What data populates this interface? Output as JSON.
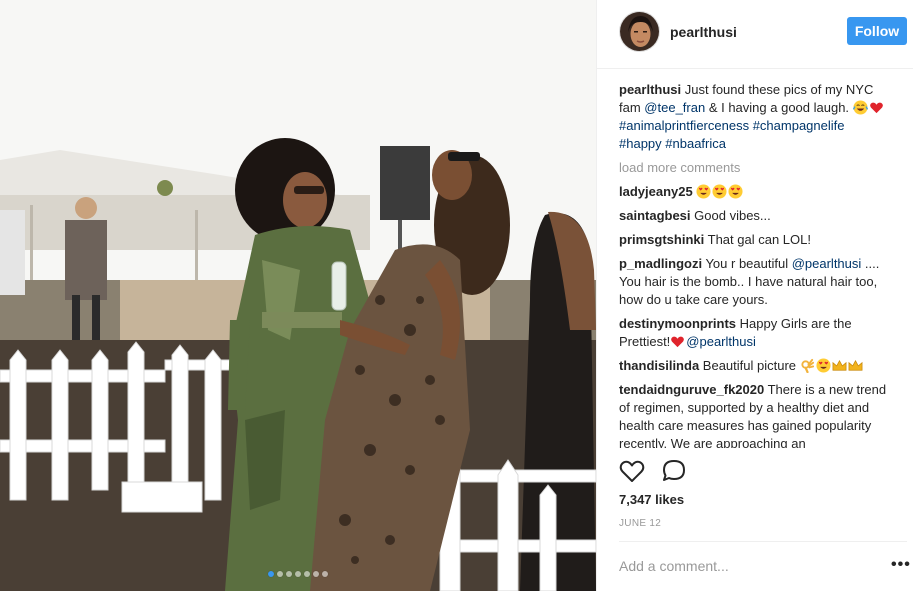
{
  "post": {
    "author": "pearlthusi",
    "follow_label": "Follow",
    "caption": {
      "text_1": "Just found these pics of my NYC fam ",
      "mention": "@tee_fran",
      "text_2": " & I having a good laugh. ",
      "emoji": [
        "face-with-tears-of-joy",
        "red-heart"
      ],
      "hashtags": [
        "#animalprintfierceness",
        "#champagnelife",
        "#happy",
        "#nbaafrica"
      ]
    },
    "load_more_label": "load more comments",
    "likes_label": "7,347 likes",
    "date_label": "JUNE 12",
    "add_comment_placeholder": "Add a comment...",
    "more_options": "•••",
    "carousel": {
      "count": 7,
      "active_index": 0
    }
  },
  "comments": [
    {
      "user": "ladyjeany25",
      "text": "",
      "emoji": [
        "heart-eyes",
        "heart-eyes",
        "heart-eyes"
      ]
    },
    {
      "user": "saintagbesi",
      "text": "Good vibes..."
    },
    {
      "user": "primsgtshinki",
      "text": "That gal can LOL!"
    },
    {
      "user": "p_madlingozi",
      "text": "You r beautiful ",
      "mention": "@pearlthusi",
      "text_after": " .... You hair is the bomb.. I have natural hair too, how do u take care yours."
    },
    {
      "user": "destinymoonprints",
      "text": "Happy Girls are the Prettiest!",
      "mention": "@pearlthusi",
      "emoji_before_mention": [
        "red-heart"
      ]
    },
    {
      "user": "thandisilinda",
      "text": "Beautiful picture ",
      "emoji": [
        "ok-hand",
        "heart-eyes",
        "crown",
        "crown"
      ]
    },
    {
      "user": "tendaidnguruve_fk2020",
      "text": "There is a new trend of regimen, supported by a healthy diet and health care measures has gained popularity recently. We are approaching an"
    }
  ],
  "icons": {
    "like": "heart-outline-icon",
    "comment": "speech-bubble-icon",
    "more": "more-options-icon"
  },
  "colors": {
    "accent": "#3897f0",
    "link": "#003569",
    "muted": "#999999",
    "text": "#262626"
  }
}
